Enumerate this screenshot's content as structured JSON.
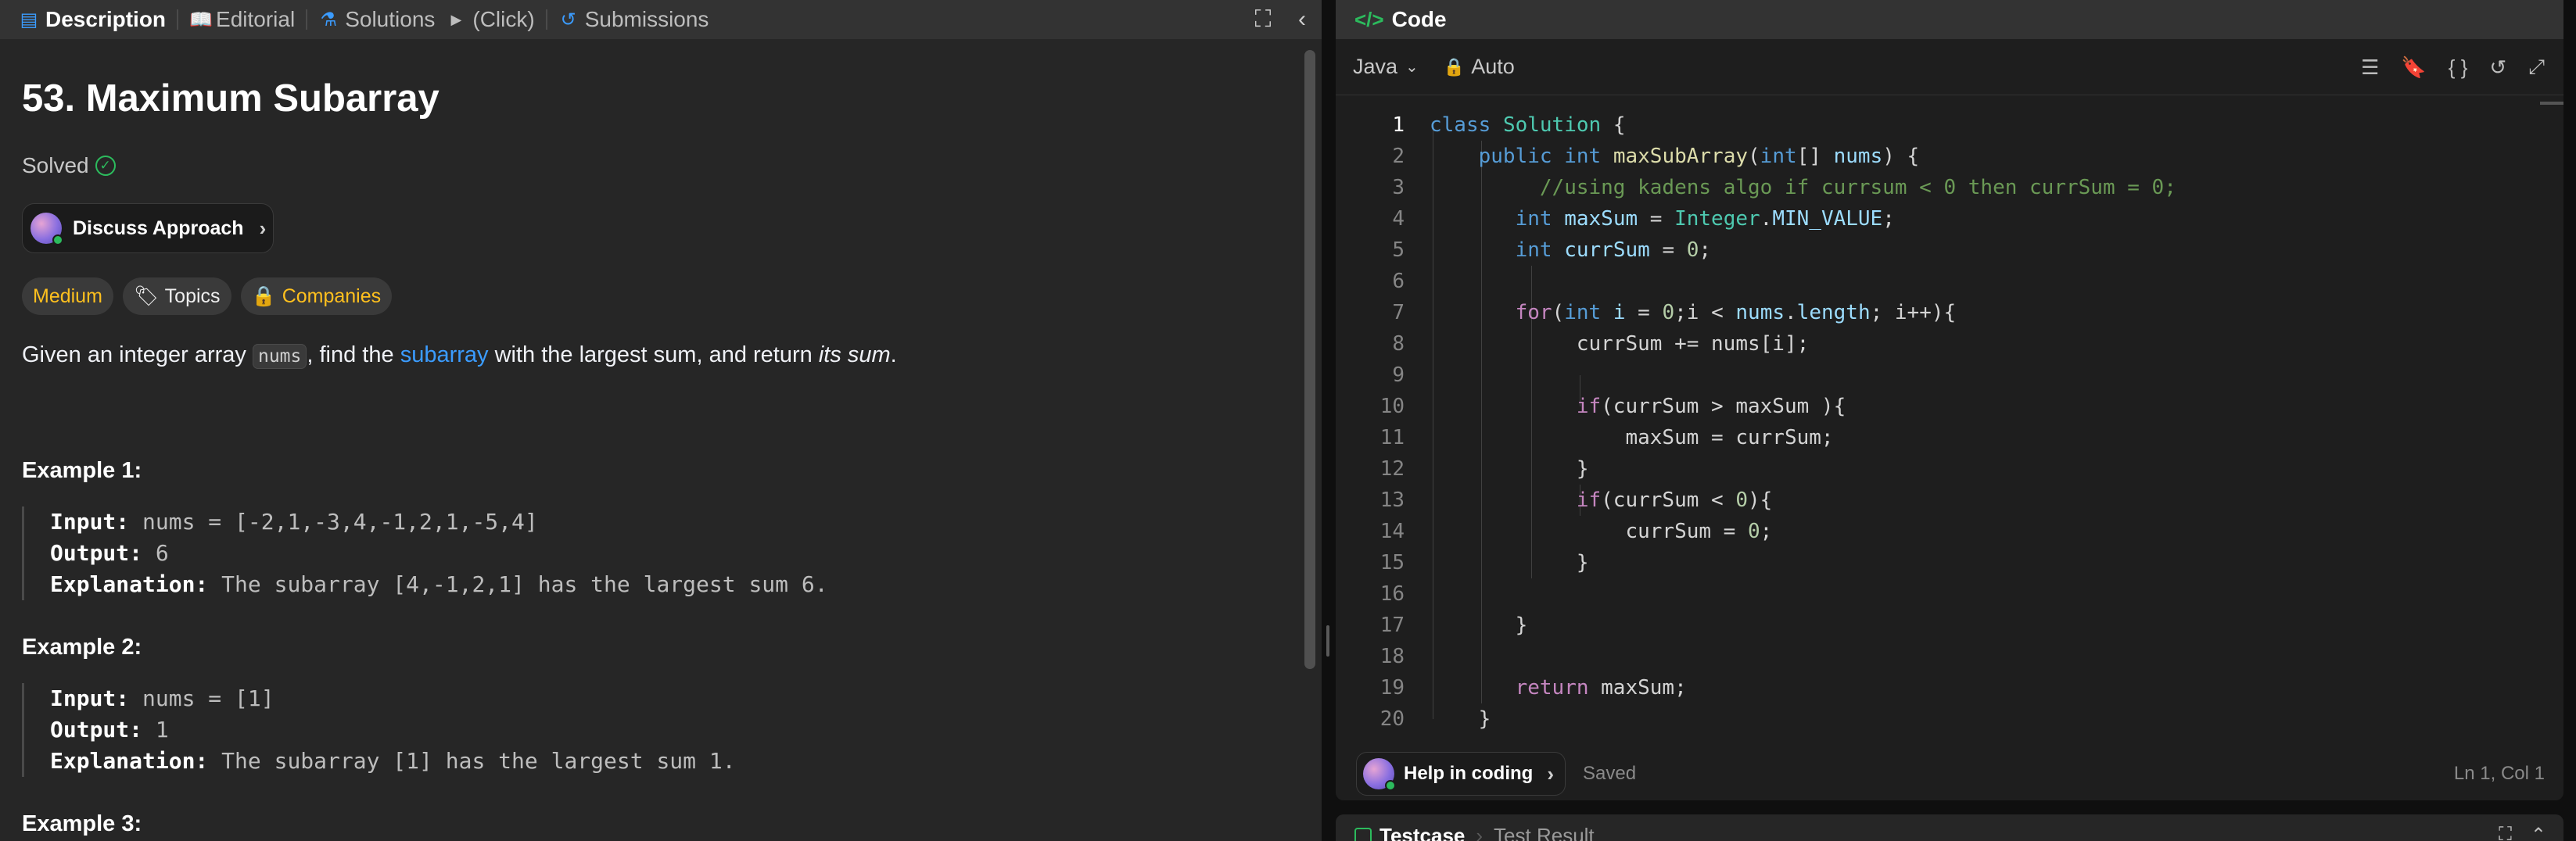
{
  "left_tabs": {
    "description": "Description",
    "editorial": "Editorial",
    "solutions": "Solutions",
    "click": "(Click)",
    "submissions": "Submissions"
  },
  "problem": {
    "title": "53. Maximum Subarray",
    "status": "Solved",
    "discuss_button": "Discuss Approach",
    "tags": {
      "difficulty": "Medium",
      "topics": "Topics",
      "companies": "Companies"
    },
    "description": {
      "part1": "Given an integer array ",
      "code": "nums",
      "part2": ", find the ",
      "link": "subarray",
      "part3": " with the largest sum, and return ",
      "italic": "its sum",
      "part4": "."
    },
    "examples": [
      {
        "title": "Example 1:",
        "input_label": "Input:",
        "input": " nums = [-2,1,-3,4,-1,2,1,-5,4]",
        "output_label": "Output:",
        "output": " 6",
        "explanation_label": "Explanation:",
        "explanation": " The subarray [4,-1,2,1] has the largest sum 6."
      },
      {
        "title": "Example 2:",
        "input_label": "Input:",
        "input": " nums = [1]",
        "output_label": "Output:",
        "output": " 1",
        "explanation_label": "Explanation:",
        "explanation": " The subarray [1] has the largest sum 1."
      },
      {
        "title": "Example 3:"
      }
    ]
  },
  "code_panel": {
    "title": "Code",
    "language": "Java",
    "mode": "Auto",
    "help_button": "Help in coding",
    "save_status": "Saved",
    "cursor": "Ln 1, Col 1",
    "lines": [
      "1",
      "2",
      "3",
      "4",
      "5",
      "6",
      "7",
      "8",
      "9",
      "10",
      "11",
      "12",
      "13",
      "14",
      "15",
      "16",
      "17",
      "18",
      "19",
      "20"
    ]
  },
  "bottom_panel": {
    "testcase_tab": "Testcase",
    "result_tab": "Test Result"
  },
  "colors": {
    "accent_green": "#2cbb5d",
    "medium": "#ffc01e",
    "link": "#3b9cff"
  }
}
